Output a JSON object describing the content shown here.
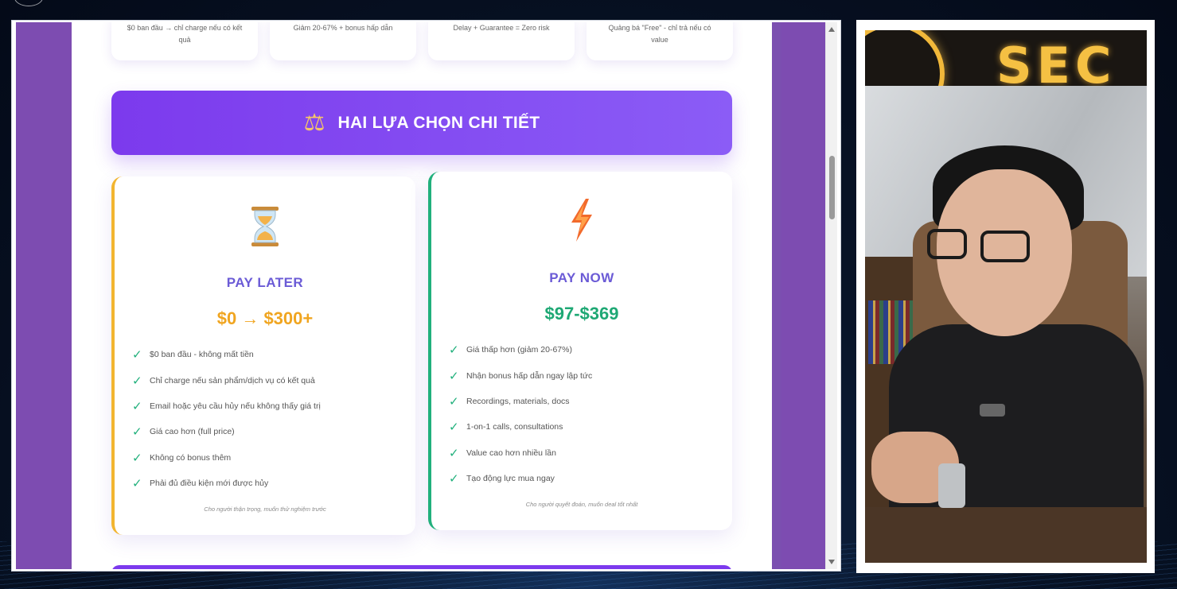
{
  "top_cards": [
    {
      "line1": "$0 ban đầu → chỉ charge nếu có kết",
      "line2": "quả"
    },
    {
      "line1": "Giảm 20-67% + bonus hấp dẫn",
      "line2": ""
    },
    {
      "line1": "Delay + Guarantee = Zero risk",
      "line2": ""
    },
    {
      "line1": "Quảng bá \"Free\" - chỉ trả nếu có",
      "line2": "value"
    }
  ],
  "banner": {
    "icon": "balance-scale-icon",
    "title": "HAI LỰA CHỌN CHI TIẾT"
  },
  "options": [
    {
      "icon": "hourglass-icon",
      "name": "PAY LATER",
      "price": "$0 → $300+",
      "features": [
        "$0 ban đầu - không mất tiền",
        "Chỉ charge nếu sản phẩm/dịch vụ có kết quả",
        "Email hoặc yêu cầu hủy nếu không thấy giá trị",
        "Giá cao hơn (full price)",
        "Không có bonus thêm",
        "Phải đủ điều kiện mới được hủy"
      ],
      "note": "Cho người thận trọng, muốn thử nghiệm trước"
    },
    {
      "icon": "lightning-bolt-icon",
      "name": "PAY NOW",
      "price": "$97-$369",
      "features": [
        "Giá thấp hơn (giảm 20-67%)",
        "Nhận bonus hấp dẫn ngay lập tức",
        "Recordings, materials, docs",
        "1-on-1 calls, consultations",
        "Value cao hơn nhiều lần",
        "Tạo động lực mua ngay"
      ],
      "note": "Cho người quyết đoán, muốn deal tốt nhất"
    }
  ],
  "check_glyph": "✓",
  "webcam": {
    "sign_text": "SEC"
  },
  "colors": {
    "banner": "#7c3aed",
    "pay_later_accent": "#f2b530",
    "pay_now_accent": "#21b07c",
    "option_name": "#6b5bd6"
  }
}
